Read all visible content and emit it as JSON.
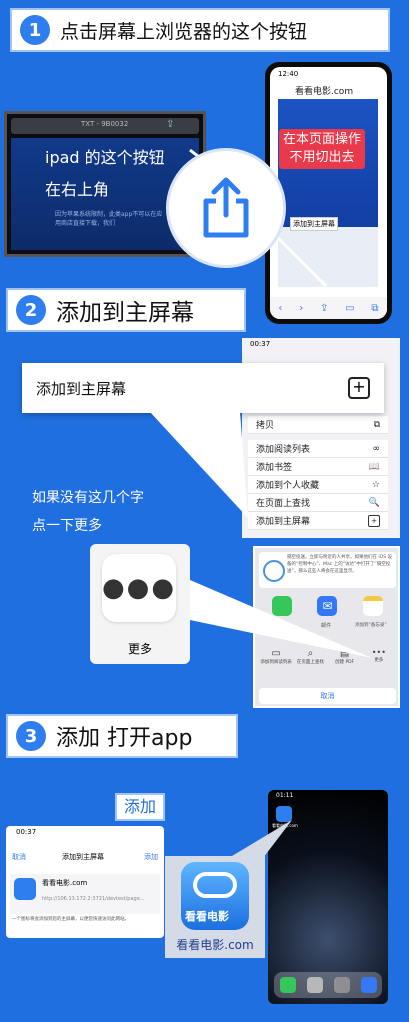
{
  "step1": {
    "num": "1",
    "title": "点击屏幕上浏览器的这个按钮"
  },
  "ipad": {
    "url_bar": "TXT - 9B0032",
    "label1": "ipad 的这个按钮",
    "label2": "在右上角",
    "blur_text": "因为苹果系统限制，此类app不可以在应用商店直接下载，我们"
  },
  "iphone_top": {
    "time": "12:40",
    "site": "看看电影.com",
    "add_home": "添加到主屏幕",
    "overlay1": "在本页面操作",
    "overlay2": "不用切出去"
  },
  "step2": {
    "num": "2",
    "title": "添加到主屏幕"
  },
  "menu": {
    "time": "00:37",
    "callout": "添加到主屏幕",
    "items": [
      {
        "label": "拷贝",
        "icon": "⧉"
      },
      {
        "label": "添加阅读列表",
        "icon": "∞"
      },
      {
        "label": "添加书签",
        "icon": "📖"
      },
      {
        "label": "添加到个人收藏",
        "icon": "☆"
      },
      {
        "label": "在页面上查找",
        "icon": "🔍"
      },
      {
        "label": "添加到主屏幕",
        "icon": "+"
      }
    ]
  },
  "hint": {
    "line1": "如果没有这几个字",
    "line2": "点一下更多"
  },
  "more": {
    "label": "更多"
  },
  "share": {
    "airdrop_text": "隔空投送。立即与附近的人共享。如果他们在 iOS 设备的“控制中心”、Mac 上的“访达”中打开了“隔空投送”，那么这些人将会在这里显示。",
    "app1": "",
    "app2": "邮件",
    "app3": "添加到“备忘录”",
    "act1": "添加到阅读列表",
    "act2": "在页面上查找",
    "act3": "创建 PDF",
    "act4": "更多",
    "cancel": "取消"
  },
  "step3": {
    "num": "3",
    "title": "添加 打开app"
  },
  "add": {
    "time": "00:37",
    "badge": "添加",
    "cancel": "取消",
    "title": "添加到主屏幕",
    "confirm": "添加",
    "app_name": "看看电影.com",
    "url": "http://106.13.172.2:3721/devtest/page...",
    "note": "一个图标将会添加到您的主屏幕，以便您快速访问此网站。"
  },
  "home": {
    "time": "01:11",
    "icon_label": "看看电影.com",
    "big_label": "看看电影.com",
    "logo_text": "看看电影"
  }
}
